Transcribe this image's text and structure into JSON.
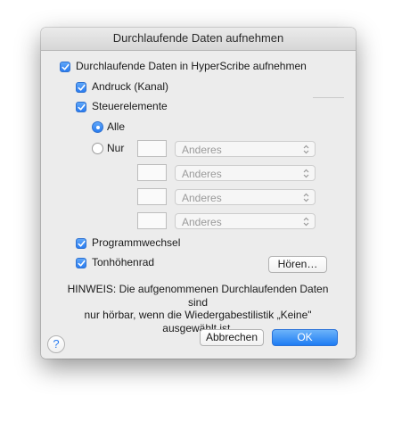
{
  "dialog": {
    "title": "Durchlaufende Daten aufnehmen",
    "main_checkbox": {
      "label": "Durchlaufende Daten in HyperScribe aufnehmen",
      "checked": true
    },
    "options": {
      "andruck": {
        "label": "Andruck (Kanal)",
        "checked": true
      },
      "steuerelemente": {
        "label": "Steuerelemente",
        "checked": true
      },
      "radio_alle": {
        "label": "Alle",
        "selected": true
      },
      "radio_nur": {
        "label": "Nur",
        "selected": false
      },
      "programmwechsel": {
        "label": "Programmwechsel",
        "checked": true
      },
      "tonhoehenrad": {
        "label": "Tonhöhenrad",
        "checked": true
      }
    },
    "controller_rows": [
      {
        "number": "",
        "popup": "Anderes"
      },
      {
        "number": "",
        "popup": "Anderes"
      },
      {
        "number": "",
        "popup": "Anderes"
      },
      {
        "number": "",
        "popup": "Anderes"
      }
    ],
    "hoeren_button": "Hören…",
    "note_line1": "HINWEIS: Die aufgenommenen Durchlaufenden Daten sind",
    "note_line2": "nur hörbar, wenn die Wiedergabestilistik „Keine\"",
    "note_line3": "ausgewählt ist.",
    "help_glyph": "?",
    "cancel_button": "Abbrechen",
    "ok_button": "OK"
  },
  "colors": {
    "accent": "#2a7cf0",
    "window_bg": "#ececec"
  },
  "icons": [
    "check-icon",
    "chevron-updown-icon",
    "help-icon"
  ]
}
